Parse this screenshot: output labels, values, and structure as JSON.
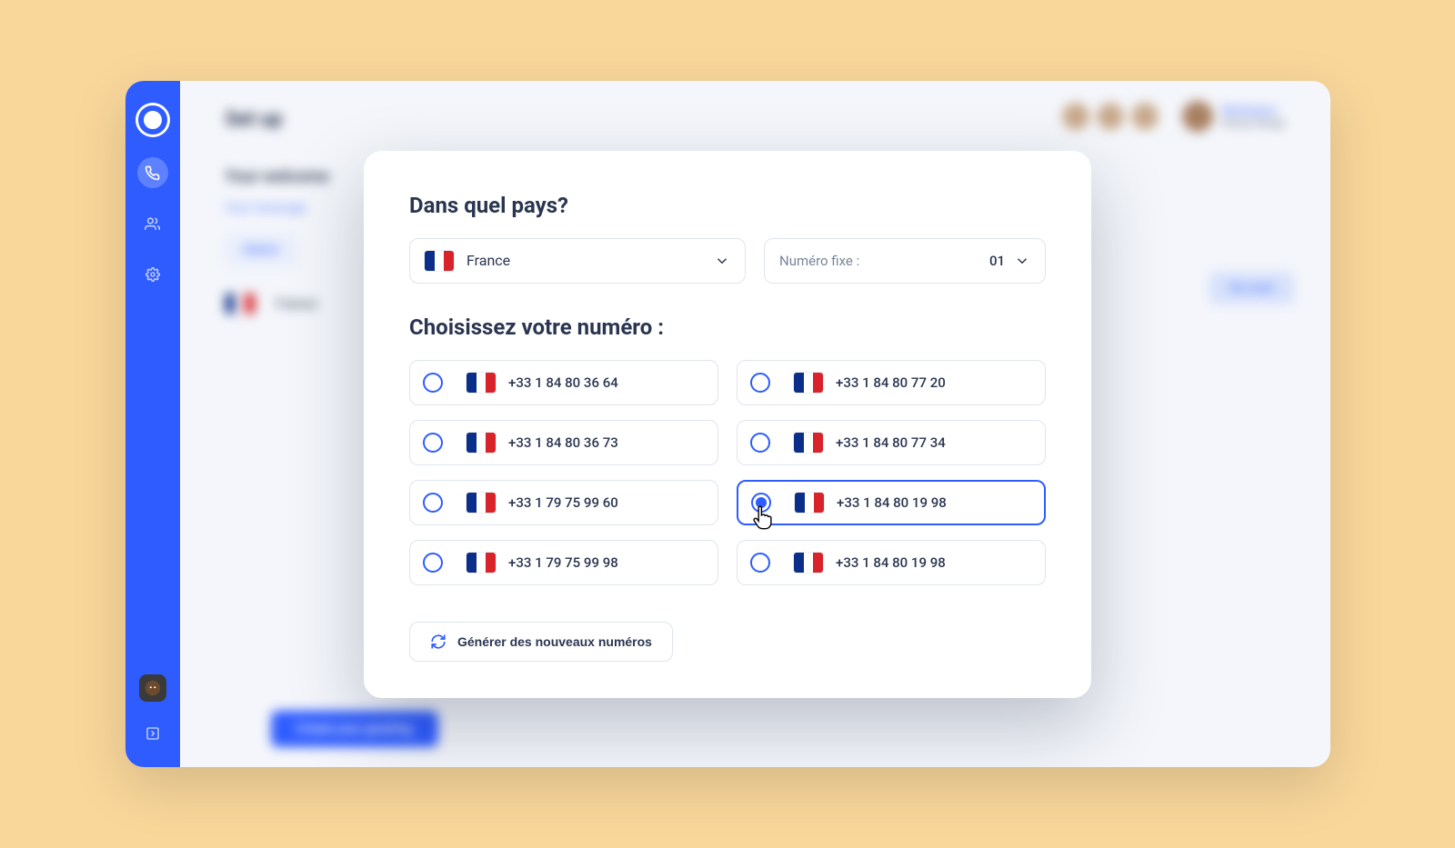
{
  "background": {
    "page_title": "Set up",
    "subheading": "Your welcome",
    "link_text": "Your message",
    "pill_text": "Select",
    "flag_label": "France",
    "right_pill": "Go next",
    "cta": "Create your greeting",
    "user_line1": "Workspace",
    "user_line2": "Phone Setup"
  },
  "modal": {
    "country_heading": "Dans quel pays?",
    "country_value": "France",
    "type_label": "Numéro fixe :",
    "type_value": "01",
    "choose_heading": "Choisissez votre numéro :",
    "numbers_left": [
      "+33 1 84 80 36 64",
      "+33 1 84 80 36 73",
      "+33 1 79 75 99 60",
      "+33 1 79 75 99 98"
    ],
    "numbers_right": [
      "+33 1 84 80 77 20",
      "+33 1 84 80 77 34",
      "+33 1 84 80 19 98",
      "+33 1 84 80 19 98"
    ],
    "selected_index_right": 2,
    "generate_button": "Générer des nouveaux numéros"
  }
}
